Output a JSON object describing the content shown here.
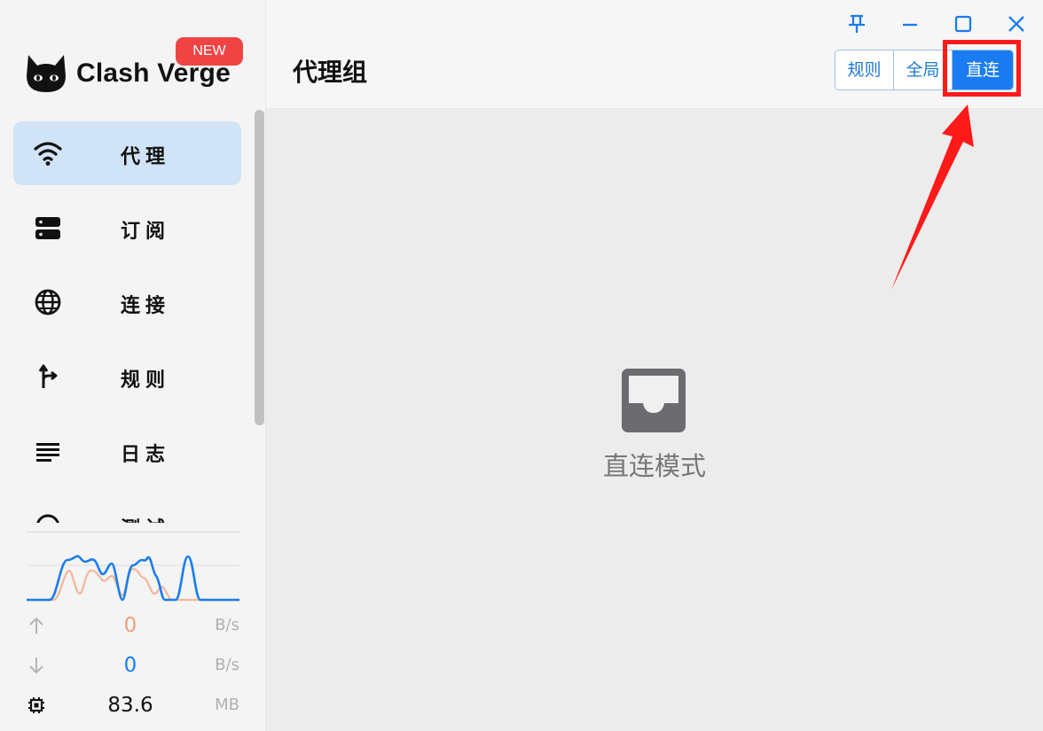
{
  "app": {
    "name": "Clash Verge",
    "badge": "NEW"
  },
  "sidebar": {
    "items": [
      {
        "label": "代理",
        "icon": "wifi-icon",
        "active": true
      },
      {
        "label": "订阅",
        "icon": "server-icon",
        "active": false
      },
      {
        "label": "连接",
        "icon": "globe-icon",
        "active": false
      },
      {
        "label": "规则",
        "icon": "route-icon",
        "active": false
      },
      {
        "label": "日志",
        "icon": "list-icon",
        "active": false
      },
      {
        "label": "测试",
        "icon": "speedometer-icon",
        "active": false
      }
    ],
    "traffic": {
      "upload": {
        "value": "0",
        "unit": "B/s",
        "color": "#f0a080",
        "icon": "arrow-up-icon"
      },
      "download": {
        "value": "0",
        "unit": "B/s",
        "color": "#1a7cf0",
        "icon": "arrow-down-icon"
      },
      "memory": {
        "value": "83.6",
        "unit": "MB",
        "icon": "chip-icon"
      }
    }
  },
  "header": {
    "title": "代理组",
    "modes": [
      {
        "label": "规则",
        "selected": false
      },
      {
        "label": "全局",
        "selected": false
      },
      {
        "label": "直连",
        "selected": true
      }
    ],
    "window_controls": [
      "pin-icon",
      "minimize-icon",
      "maximize-icon",
      "close-icon"
    ]
  },
  "main": {
    "empty_icon": "inbox-icon",
    "empty_text": "直连模式"
  },
  "colors": {
    "accent": "#1a7cf0",
    "active_nav_bg": "#d1e3f6",
    "badge": "#f04444",
    "annotation": "#ff1a1a"
  }
}
